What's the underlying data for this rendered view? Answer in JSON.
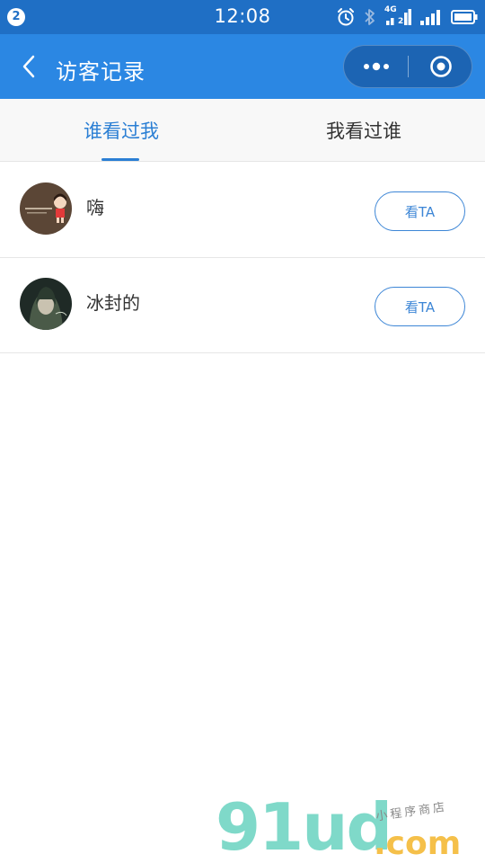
{
  "status_bar": {
    "notification_count": "2",
    "time": "12:08",
    "network": "4G",
    "sim": "2",
    "icons": [
      "notification-badge-icon",
      "alarm-icon",
      "bluetooth-icon",
      "signal-4g-icon",
      "signal-icon",
      "battery-icon"
    ]
  },
  "header": {
    "title": "访客记录",
    "background": "#2b87e3",
    "icons": [
      "back-chevron-icon",
      "more-dots-icon",
      "close-target-icon"
    ]
  },
  "tabs": [
    {
      "label": "谁看过我",
      "active": true
    },
    {
      "label": "我看过谁",
      "active": false
    }
  ],
  "accent_color": "#2b7fd4",
  "visitors": [
    {
      "name": "嗨",
      "button_label": "看TA"
    },
    {
      "name": "冰封的",
      "button_label": "看TA"
    }
  ],
  "watermark": {
    "main": "91ud",
    "domain": ".com",
    "tagline": "小程序商店"
  }
}
